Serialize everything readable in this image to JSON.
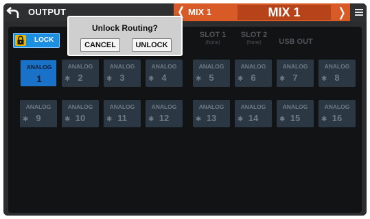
{
  "header": {
    "page_title": "OUTPUT",
    "mix_prev_label": "MIX 1",
    "mix_title": "MIX 1"
  },
  "lock": {
    "label": "LOCK"
  },
  "tabs": {
    "slot1": "SLOT 1",
    "slot1_sub": "(None)",
    "slot2": "SLOT 2",
    "slot2_sub": "(None)",
    "usb": "USB OUT"
  },
  "channels": [
    {
      "label": "ANALOG",
      "num": "1",
      "star": false,
      "selected": true
    },
    {
      "label": "ANALOG",
      "num": "2",
      "star": true
    },
    {
      "label": "ANALOG",
      "num": "3",
      "star": true
    },
    {
      "label": "ANALOG",
      "num": "4",
      "star": true
    },
    {
      "label": "ANALOG",
      "num": "5",
      "star": true
    },
    {
      "label": "ANALOG",
      "num": "6",
      "star": true
    },
    {
      "label": "ANALOG",
      "num": "7",
      "star": true
    },
    {
      "label": "ANALOG",
      "num": "8",
      "star": true
    },
    {
      "label": "ANALOG",
      "num": "9",
      "star": true
    },
    {
      "label": "ANALOG",
      "num": "10",
      "star": true
    },
    {
      "label": "ANALOG",
      "num": "11",
      "star": true
    },
    {
      "label": "ANALOG",
      "num": "12",
      "star": true
    },
    {
      "label": "ANALOG",
      "num": "13",
      "star": true
    },
    {
      "label": "ANALOG",
      "num": "14",
      "star": true
    },
    {
      "label": "ANALOG",
      "num": "15",
      "star": true
    },
    {
      "label": "ANALOG",
      "num": "16",
      "star": true
    }
  ],
  "popup": {
    "title": "Unlock Routing?",
    "cancel": "CANCEL",
    "unlock": "UNLOCK"
  },
  "colors": {
    "accent_orange": "#d85a26",
    "selected_blue": "#1a72c8",
    "lock_blue": "#1d8fe0",
    "lock_yellow": "#e9b400"
  },
  "icons": {
    "back": "back-arrow-icon",
    "lock": "padlock-icon",
    "menu": "hamburger-menu-icon",
    "prev": "chevron-left-icon",
    "next": "chevron-right-icon"
  }
}
